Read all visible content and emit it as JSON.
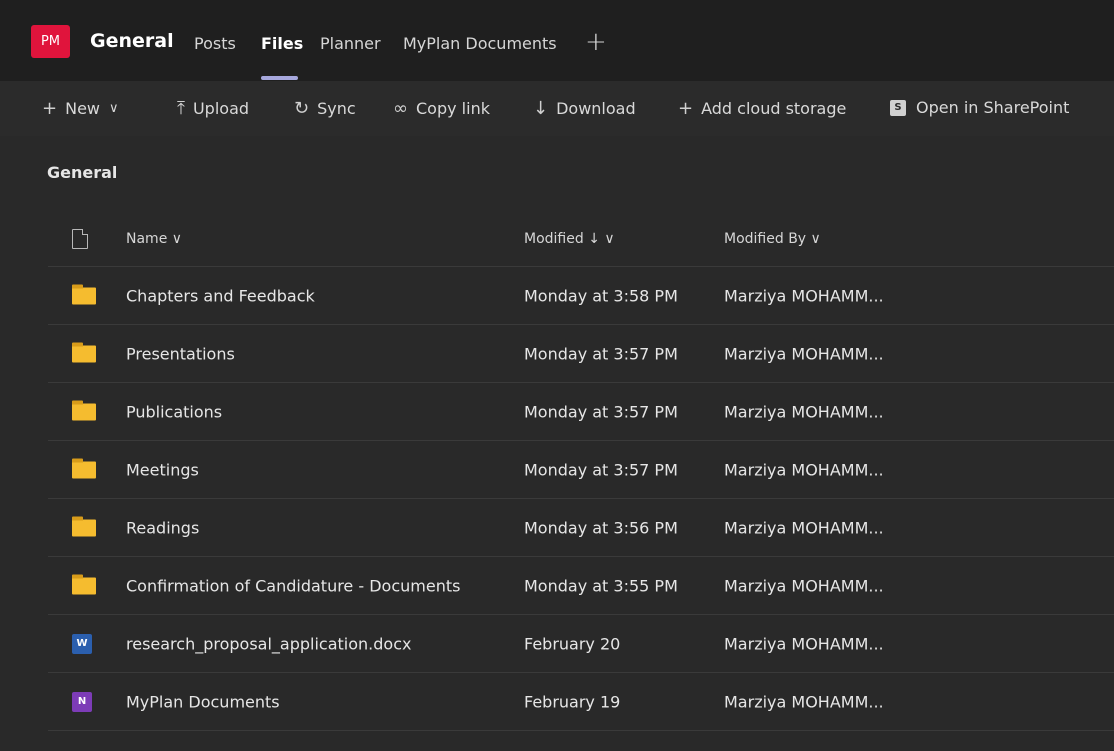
{
  "header": {
    "avatar": "PM",
    "channel": "General",
    "tabs": [
      {
        "label": "Posts"
      },
      {
        "label": "Files"
      },
      {
        "label": "Planner"
      },
      {
        "label": "MyPlan Documents"
      }
    ],
    "add_tab": "+"
  },
  "toolbar": {
    "new": "New",
    "upload": "Upload",
    "sync": "Sync",
    "copy_link": "Copy link",
    "download": "Download",
    "add_cloud": "Add cloud storage",
    "open_sharepoint": "Open in SharePoint"
  },
  "breadcrumb": "General",
  "columns": {
    "name": "Name ∨",
    "modified": "Modified ↓ ∨",
    "modified_by": "Modified By ∨"
  },
  "rows": [
    {
      "name": "Chapters and Feedback",
      "modified": "Monday at 3:58 PM",
      "by": "Marziya MOHAMM...",
      "type": "folder-icon"
    },
    {
      "name": "Presentations",
      "modified": "Monday at 3:57 PM",
      "by": "Marziya MOHAMM...",
      "type": "folder-icon"
    },
    {
      "name": "Publications",
      "modified": "Monday at 3:57 PM",
      "by": "Marziya MOHAMM...",
      "type": "folder-icon"
    },
    {
      "name": "Meetings",
      "modified": "Monday at 3:57 PM",
      "by": "Marziya MOHAMM...",
      "type": "folder-icon"
    },
    {
      "name": "Readings",
      "modified": "Monday at 3:56 PM",
      "by": "Marziya MOHAMM...",
      "type": "folder-icon"
    },
    {
      "name": "Confirmation of Candidature - Documents",
      "modified": "Monday at 3:55 PM",
      "by": "Marziya MOHAMM...",
      "type": "folder-icon"
    },
    {
      "name": "research_proposal_application.docx",
      "modified": "February 20",
      "by": "Marziya MOHAMM...",
      "type": "word-icon"
    },
    {
      "name": "MyPlan Documents",
      "modified": "February 19",
      "by": "Marziya MOHAMM...",
      "type": "onenote-icon"
    }
  ],
  "icon_letters": {
    "word": "W",
    "onenote": "N"
  },
  "colors": {
    "avatar": "#e0143c",
    "active_tab_underline": "#a6a7dc",
    "folder": "#f5bc2f",
    "word": "#2b5fae",
    "onenote": "#7d3cb7"
  }
}
